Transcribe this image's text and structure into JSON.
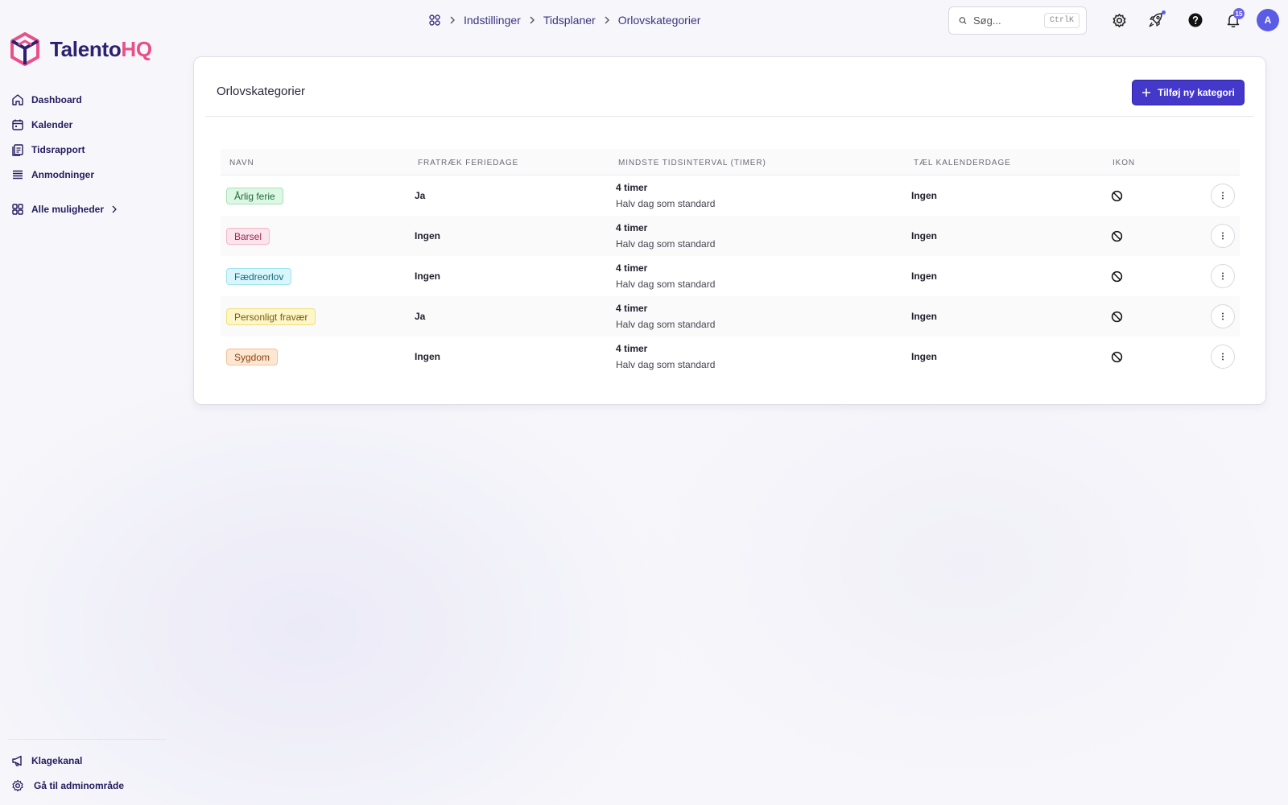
{
  "brand": {
    "name_part1": "Talento",
    "name_part2": "HQ",
    "color_primary": "#2b2170",
    "color_accent": "#e8508a"
  },
  "sidebar": {
    "items": [
      {
        "label": "Dashboard",
        "icon": "home-icon"
      },
      {
        "label": "Kalender",
        "icon": "calendar-icon"
      },
      {
        "label": "Tidsrapport",
        "icon": "clipboard-icon"
      },
      {
        "label": "Anmodninger",
        "icon": "list-icon"
      }
    ],
    "all_options": {
      "label": "Alle muligheder",
      "icon": "grid-icon"
    },
    "bottom": [
      {
        "label": "Klagekanal",
        "icon": "megaphone-icon"
      },
      {
        "label": "Gå til adminområde",
        "icon": "gear-icon"
      }
    ]
  },
  "breadcrumb": {
    "items": [
      "Indstillinger",
      "Tidsplaner",
      "Orlovskategorier"
    ]
  },
  "search": {
    "placeholder": "Søg...",
    "shortcut": "CtrlK"
  },
  "notifications": {
    "count": "15"
  },
  "user": {
    "initial": "A"
  },
  "page": {
    "title": "Orlovskategorier",
    "add_button": "Tilføj ny kategori",
    "accent": "#4338ca"
  },
  "table": {
    "headers": [
      "NAVN",
      "FRATRÆK FERIEDAGE",
      "MINDSTE TIDSINTERVAL (TIMER)",
      "TÆL KALENDERDAGE",
      "IKON"
    ],
    "rows": [
      {
        "name": "Årlig ferie",
        "deduct": "Ja",
        "interval": "4 timer",
        "interval_note": "Halv dag som standard",
        "calendar_days": "Ingen",
        "tag_bg": "#dcf7e3",
        "tag_border": "#a7e3b9",
        "tag_color": "#1f6b36"
      },
      {
        "name": "Barsel",
        "deduct": "Ingen",
        "interval": "4 timer",
        "interval_note": "Halv dag som standard",
        "calendar_days": "Ingen",
        "tag_bg": "#fde3ec",
        "tag_border": "#f5b7cb",
        "tag_color": "#9b2550"
      },
      {
        "name": "Fædreorlov",
        "deduct": "Ingen",
        "interval": "4 timer",
        "interval_note": "Halv dag som standard",
        "calendar_days": "Ingen",
        "tag_bg": "#d8f6fb",
        "tag_border": "#9fe3ee",
        "tag_color": "#146b7a"
      },
      {
        "name": "Personligt fravær",
        "deduct": "Ja",
        "interval": "4 timer",
        "interval_note": "Halv dag som standard",
        "calendar_days": "Ingen",
        "tag_bg": "#fdf6c8",
        "tag_border": "#f1df7c",
        "tag_color": "#7a5c0a"
      },
      {
        "name": "Sygdom",
        "deduct": "Ingen",
        "interval": "4 timer",
        "interval_note": "Halv dag som standard",
        "calendar_days": "Ingen",
        "tag_bg": "#fde6d2",
        "tag_border": "#f5c29a",
        "tag_color": "#8a4514"
      }
    ]
  }
}
